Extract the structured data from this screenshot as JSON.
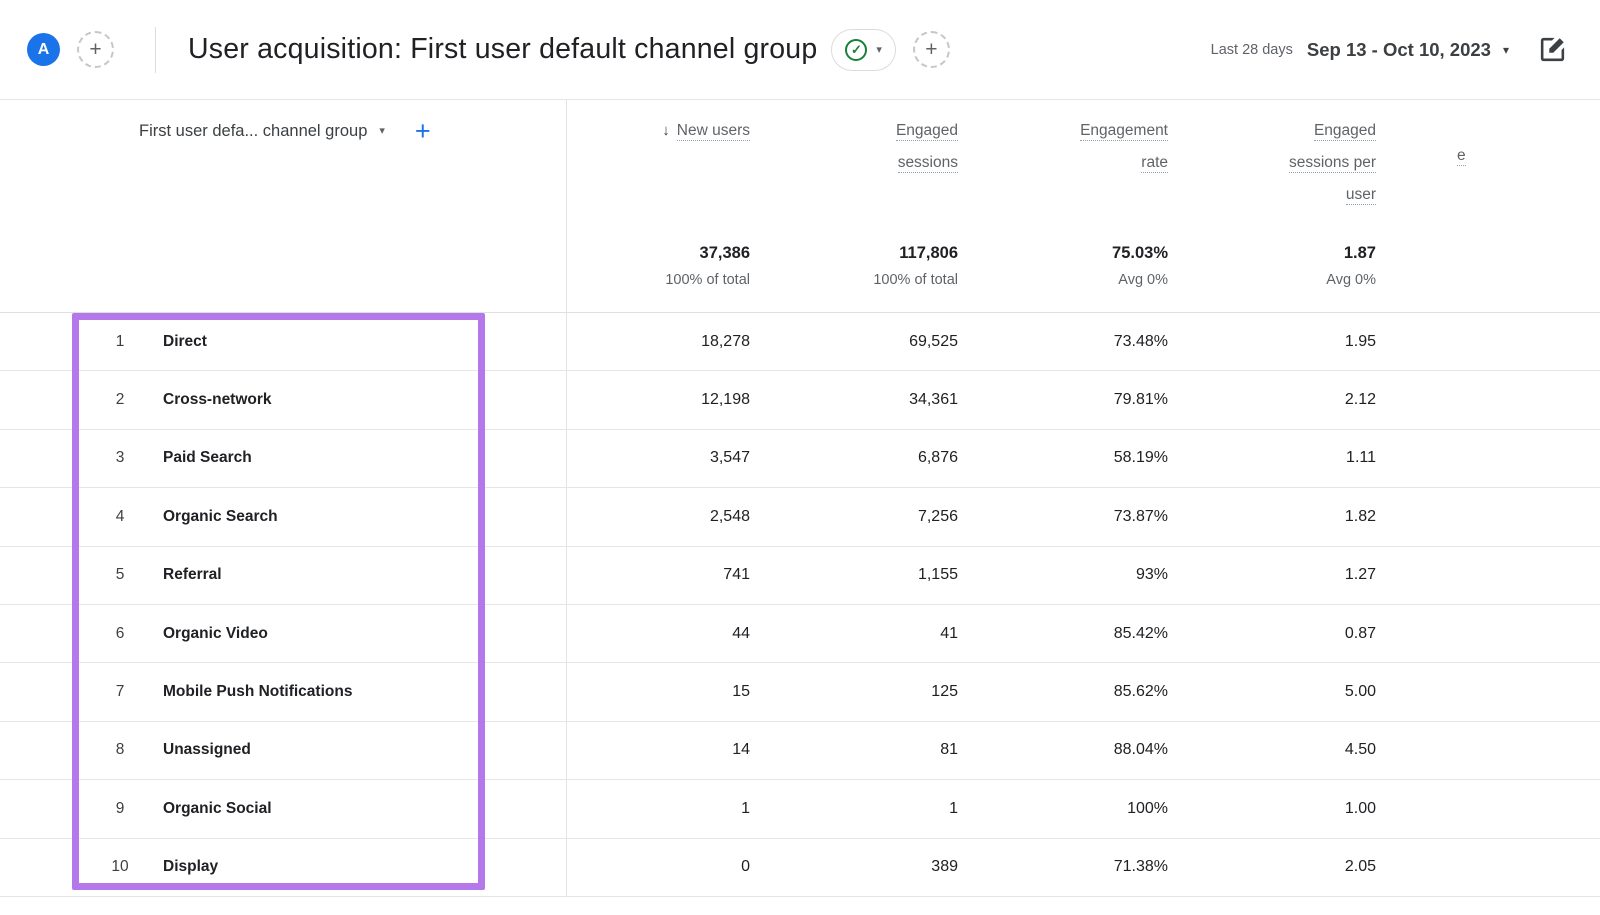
{
  "colors": {
    "avatar_blue": "#1a73e8",
    "check_green": "#188038",
    "add_dimension_blue": "#1a73e8",
    "highlight_purple": "#b578ea"
  },
  "icons": {
    "plus": "+",
    "caret_down": "▾",
    "sort_descending": "↓",
    "check": "✓"
  },
  "header": {
    "avatar_letter": "A",
    "title": "User acquisition: First user default channel group",
    "date_preset_label": "Last 28 days",
    "date_range": "Sep 13 - Oct 10, 2023"
  },
  "table": {
    "dimension_header": "First user defa... channel group",
    "next_column_partial_label": "e",
    "metric_columns": [
      {
        "label_lines": [
          "New users"
        ],
        "total": "37,386",
        "total_sub": "100% of total"
      },
      {
        "label_lines": [
          "Engaged",
          "sessions"
        ],
        "total": "117,806",
        "total_sub": "100% of total"
      },
      {
        "label_lines": [
          "Engagement",
          "rate"
        ],
        "total": "75.03%",
        "total_sub": "Avg 0%"
      },
      {
        "label_lines": [
          "Engaged",
          "sessions per",
          "user"
        ],
        "total": "1.87",
        "total_sub": "Avg 0%"
      }
    ],
    "rows": [
      {
        "index": "1",
        "channel": "Direct",
        "values": [
          "18,278",
          "69,525",
          "73.48%",
          "1.95"
        ]
      },
      {
        "index": "2",
        "channel": "Cross-network",
        "values": [
          "12,198",
          "34,361",
          "79.81%",
          "2.12"
        ]
      },
      {
        "index": "3",
        "channel": "Paid Search",
        "values": [
          "3,547",
          "6,876",
          "58.19%",
          "1.11"
        ]
      },
      {
        "index": "4",
        "channel": "Organic Search",
        "values": [
          "2,548",
          "7,256",
          "73.87%",
          "1.82"
        ]
      },
      {
        "index": "5",
        "channel": "Referral",
        "values": [
          "741",
          "1,155",
          "93%",
          "1.27"
        ]
      },
      {
        "index": "6",
        "channel": "Organic Video",
        "values": [
          "44",
          "41",
          "85.42%",
          "0.87"
        ]
      },
      {
        "index": "7",
        "channel": "Mobile Push Notifications",
        "values": [
          "15",
          "125",
          "85.62%",
          "5.00"
        ]
      },
      {
        "index": "8",
        "channel": "Unassigned",
        "values": [
          "14",
          "81",
          "88.04%",
          "4.50"
        ]
      },
      {
        "index": "9",
        "channel": "Organic Social",
        "values": [
          "1",
          "1",
          "100%",
          "1.00"
        ]
      },
      {
        "index": "10",
        "channel": "Display",
        "values": [
          "0",
          "389",
          "71.38%",
          "2.05"
        ]
      }
    ]
  }
}
